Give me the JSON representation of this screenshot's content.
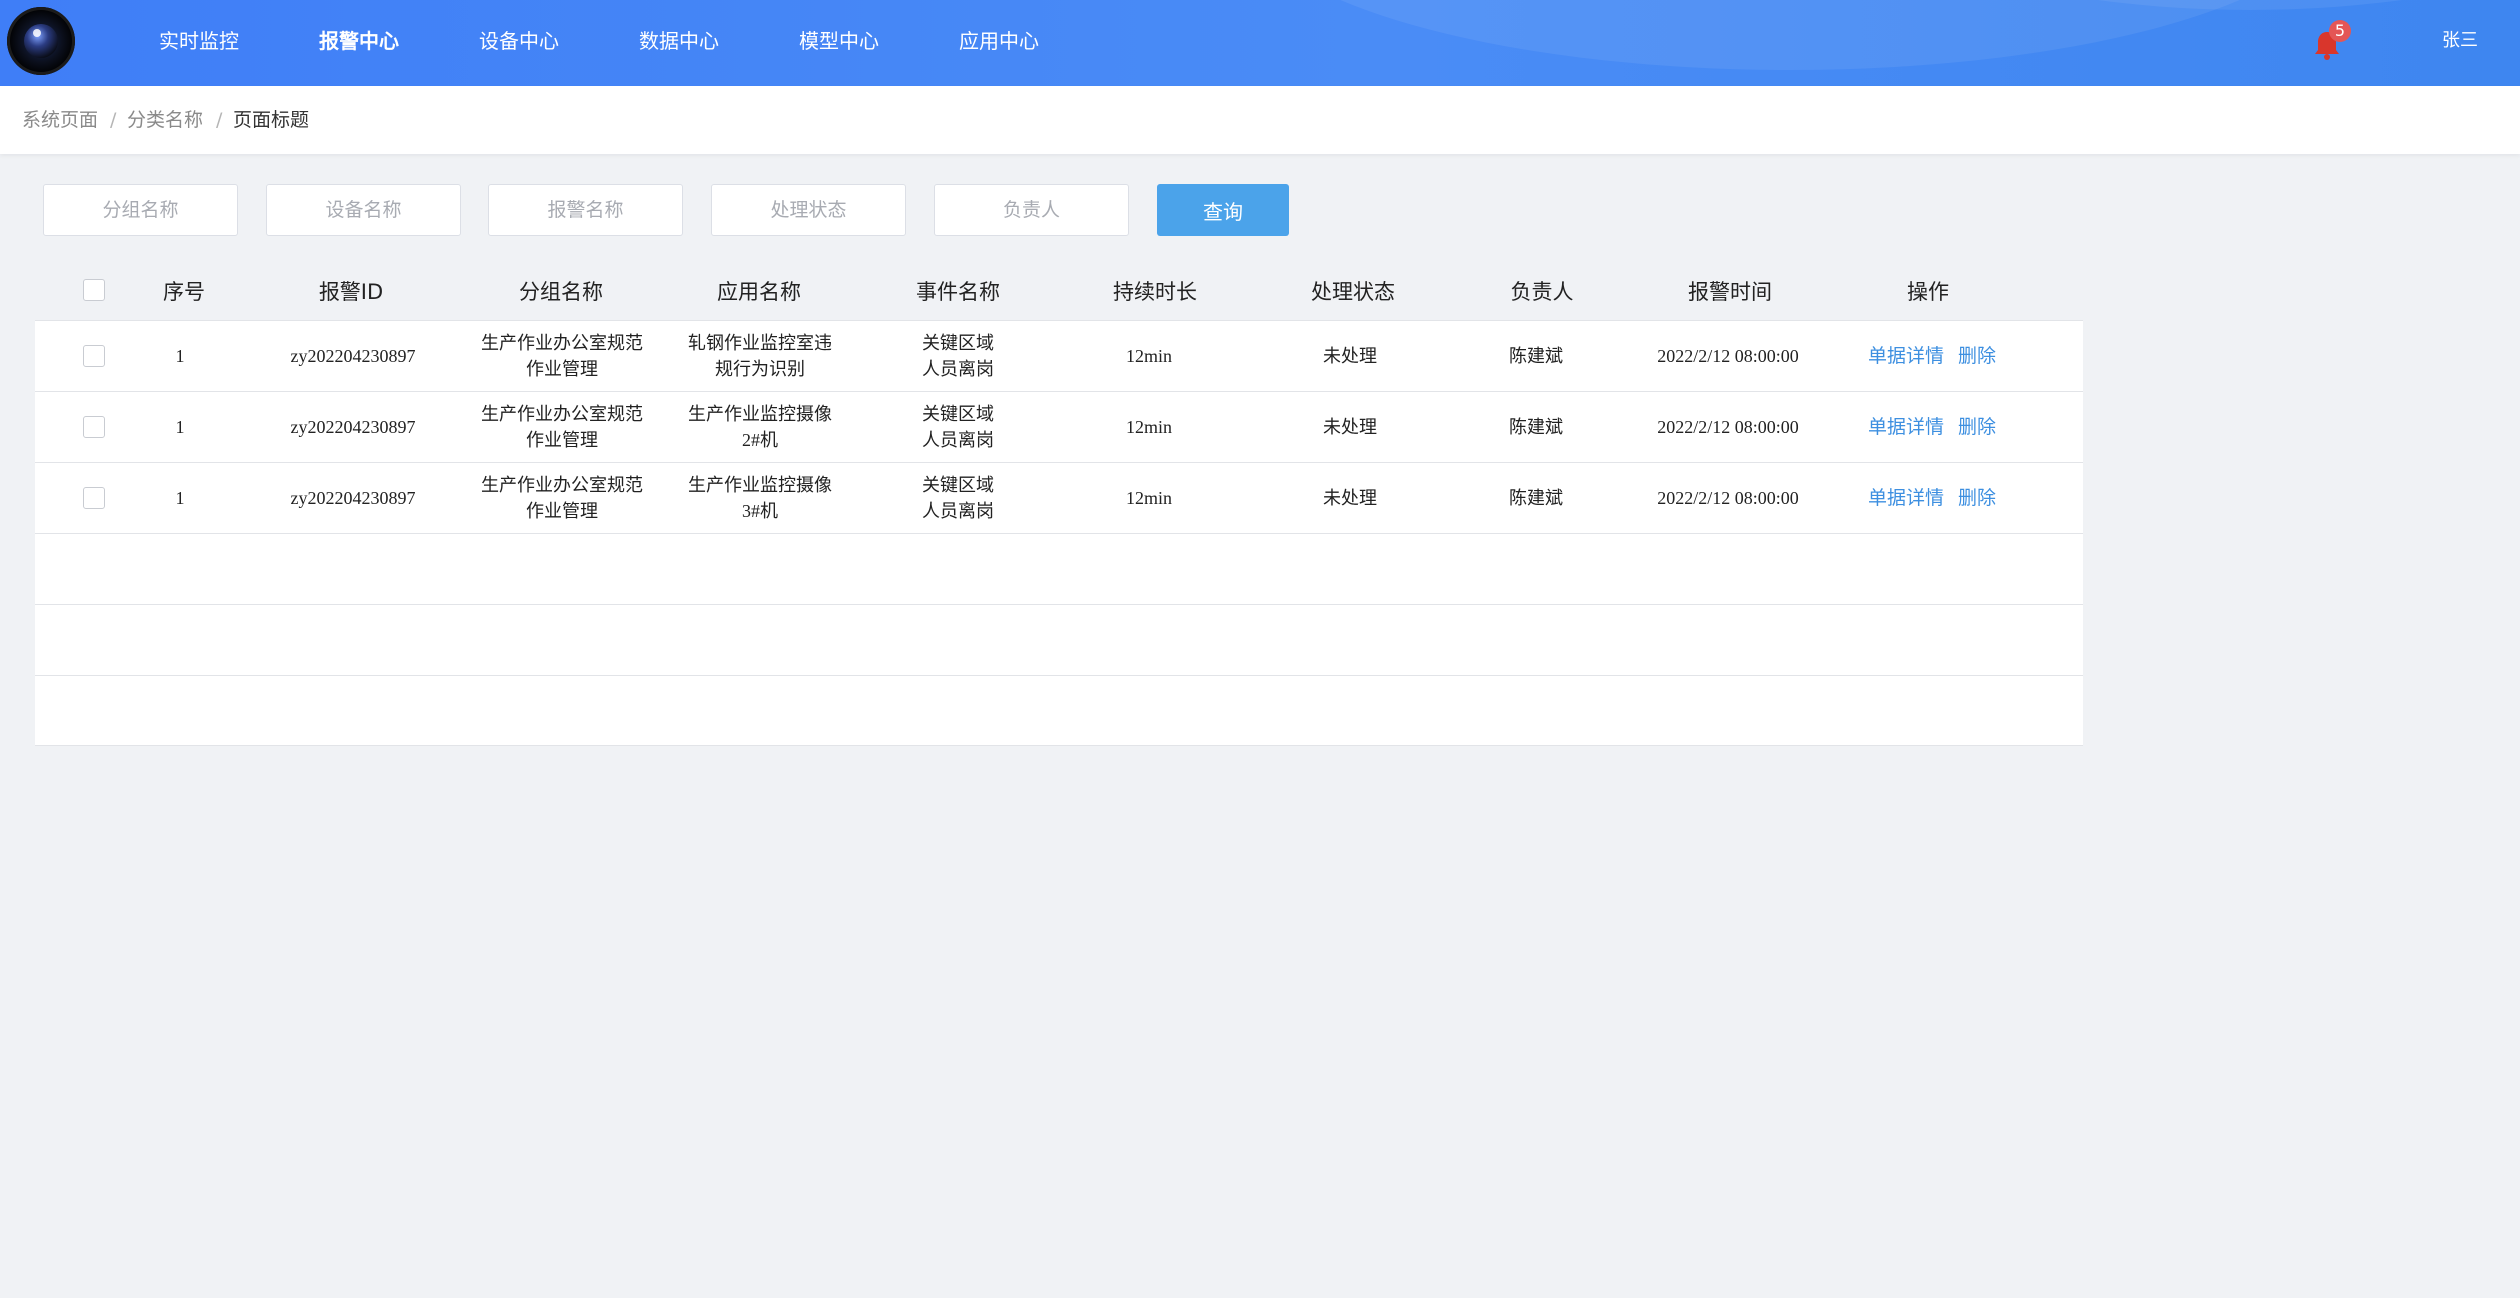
{
  "nav": {
    "items": [
      {
        "label": "实时监控"
      },
      {
        "label": "报警中心"
      },
      {
        "label": "设备中心"
      },
      {
        "label": "数据中心"
      },
      {
        "label": "模型中心"
      },
      {
        "label": "应用中心"
      }
    ],
    "active": "报警中心",
    "notification_count": "5",
    "user": "张三"
  },
  "breadcrumb": [
    "系统页面",
    "分类名称",
    "页面标题"
  ],
  "filters": {
    "group_placeholder": "分组名称",
    "device_placeholder": "设备名称",
    "alarm_placeholder": "报警名称",
    "status_placeholder": "处理状态",
    "owner_placeholder": "负责人",
    "query_label": "查询"
  },
  "table": {
    "columns": [
      "序号",
      "报警ID",
      "分组名称",
      "应用名称",
      "事件名称",
      "持续时长",
      "处理状态",
      "负责人",
      "报警时间",
      "操作"
    ],
    "rows": [
      {
        "index": "1",
        "alarm_id": "zy202204230897",
        "group_line1": "生产作业办公室规范",
        "group_line2": "作业管理",
        "app_line1": "轧钢作业监控室违",
        "app_line2": "规行为识别",
        "event_line1": "关键区域",
        "event_line2": "人员离岗",
        "duration": "12min",
        "status": "未处理",
        "owner": "陈建斌",
        "time": "2022/2/12 08:00:00",
        "op_detail": "单据详情",
        "op_delete": "删除"
      },
      {
        "index": "1",
        "alarm_id": "zy202204230897",
        "group_line1": "生产作业办公室规范",
        "group_line2": "作业管理",
        "app_line1": "生产作业监控摄像",
        "app_line2": "2#机",
        "event_line1": "关键区域",
        "event_line2": "人员离岗",
        "duration": "12min",
        "status": "未处理",
        "owner": "陈建斌",
        "time": "2022/2/12 08:00:00",
        "op_detail": "单据详情",
        "op_delete": "删除"
      },
      {
        "index": "1",
        "alarm_id": "zy202204230897",
        "group_line1": "生产作业办公室规范",
        "group_line2": "作业管理",
        "app_line1": "生产作业监控摄像",
        "app_line2": "3#机",
        "event_line1": "关键区域",
        "event_line2": "人员离岗",
        "duration": "12min",
        "status": "未处理",
        "owner": "陈建斌",
        "time": "2022/2/12 08:00:00",
        "op_detail": "单据详情",
        "op_delete": "删除"
      }
    ],
    "empty_rows": 3
  },
  "colors": {
    "header_gradient_start": "#3f7ef7",
    "header_gradient_end": "#3e86f0",
    "query_button": "#4ba3ea",
    "link": "#3d8fe0",
    "badge": "#e45656",
    "bell": "#d9362c"
  },
  "icons": {
    "logo": "camera-lens-logo",
    "notification": "bell-icon"
  }
}
